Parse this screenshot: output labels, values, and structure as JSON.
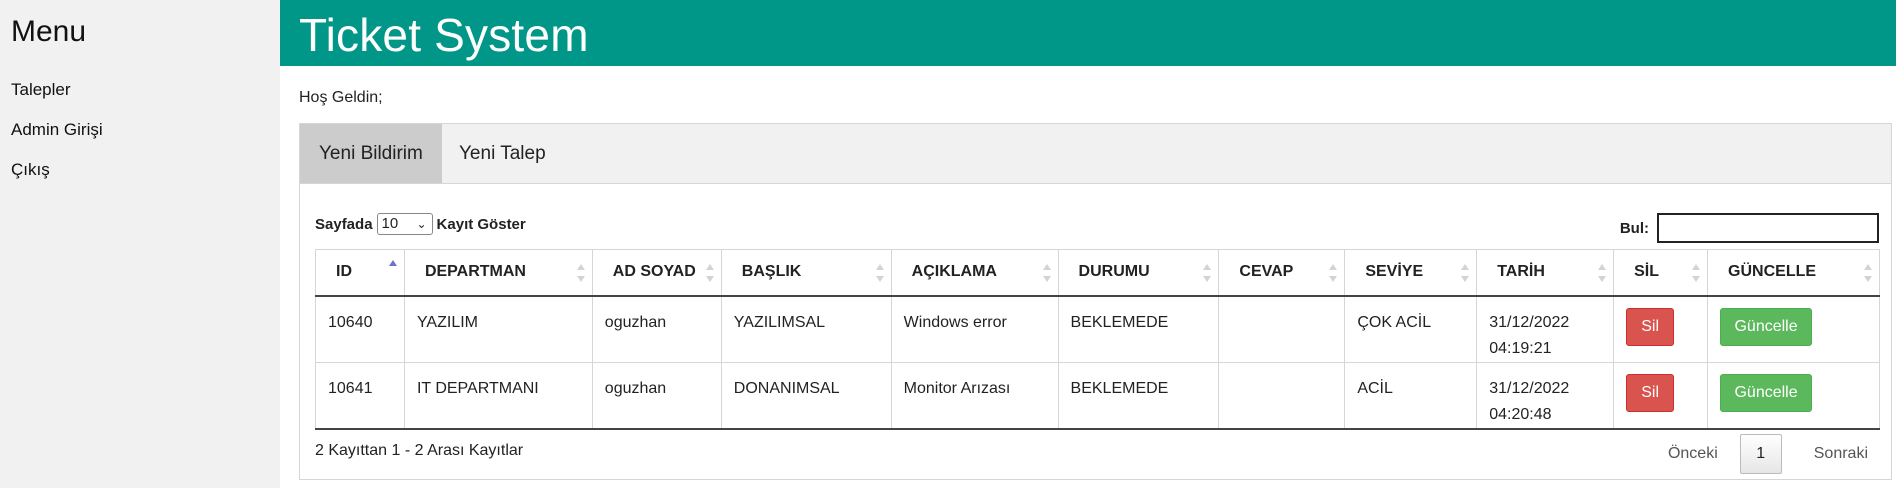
{
  "sidebar": {
    "title": "Menu",
    "items": [
      {
        "label": "Talepler"
      },
      {
        "label": "Admin Girişi"
      },
      {
        "label": "Çıkış"
      }
    ]
  },
  "header": {
    "title": "Ticket System"
  },
  "welcome": "Hoş Geldin;",
  "tabs": [
    {
      "label": "Yeni Bildirim",
      "active": true
    },
    {
      "label": "Yeni Talep",
      "active": false
    }
  ],
  "table_controls": {
    "length_prefix": "Sayfada",
    "length_value": "10",
    "length_suffix": "Kayıt Göster",
    "search_label": "Bul:",
    "search_value": ""
  },
  "table": {
    "columns": [
      "ID",
      "DEPARTMAN",
      "AD SOYAD",
      "BAŞLIK",
      "AÇIKLAMA",
      "DURUMU",
      "CEVAP",
      "SEVİYE",
      "TARİH",
      "SİL",
      "GÜNCELLE"
    ],
    "rows": [
      {
        "id": "10640",
        "departman": "YAZILIM",
        "ad_soyad": "oguzhan",
        "baslik": "YAZILIMSAL",
        "aciklama": "Windows error",
        "durumu": "BEKLEMEDE",
        "cevap": "",
        "seviye": "ÇOK ACİL",
        "tarih_date": "31/12/2022",
        "tarih_time": "04:19:21",
        "delete_label": "Sil",
        "update_label": "Güncelle"
      },
      {
        "id": "10641",
        "departman": "IT DEPARTMANI",
        "ad_soyad": "oguzhan",
        "baslik": "DONANIMSAL",
        "aciklama": "Monitor Arızası",
        "durumu": "BEKLEMEDE",
        "cevap": "",
        "seviye": "ACİL",
        "tarih_date": "31/12/2022",
        "tarih_time": "04:20:48",
        "delete_label": "Sil",
        "update_label": "Güncelle"
      }
    ]
  },
  "footer": {
    "info": "2 Kayıttan 1 - 2 Arası Kayıtlar",
    "prev_label": "Önceki",
    "current_page": "1",
    "next_label": "Sonraki"
  },
  "colors": {
    "header_bg": "#009688",
    "sidebar_bg": "#f1f1f1",
    "delete_button": "#d9534f",
    "update_button": "#5cb85c",
    "active_tab": "#cccccc",
    "sort_active": "#6d73c9"
  }
}
